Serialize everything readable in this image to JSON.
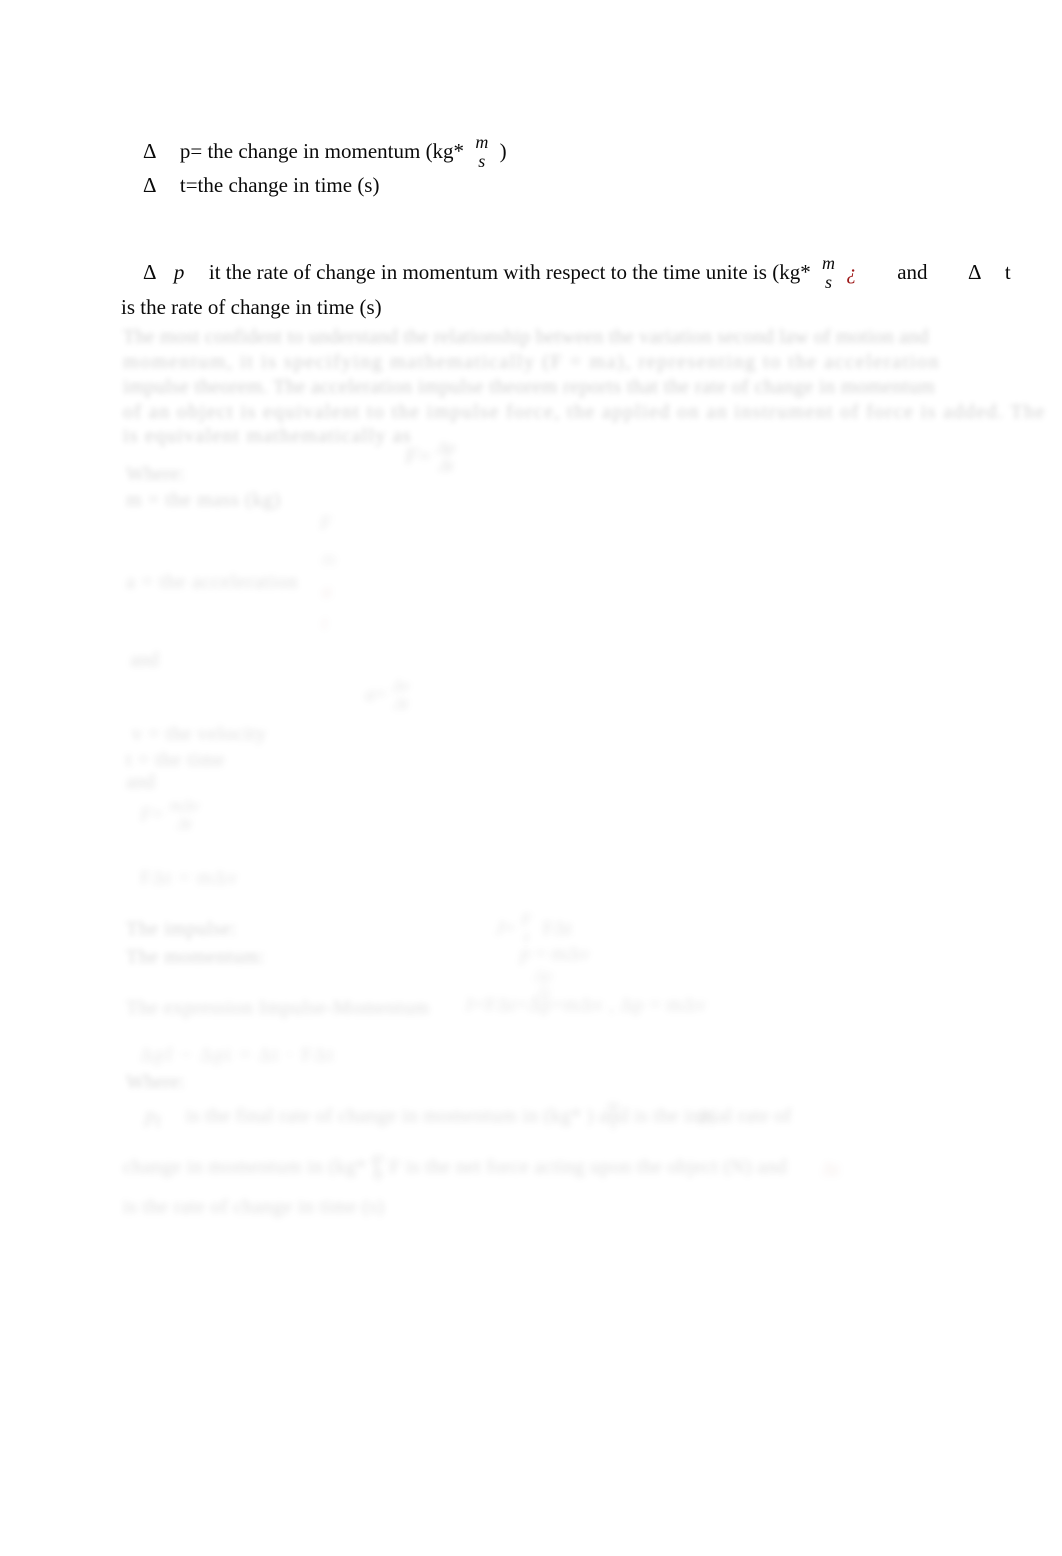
{
  "document": {
    "type": "physics-notes",
    "topic": "Impulse and momentum",
    "page_background": "#ffffff",
    "text_color": "#0a0a0a",
    "accent_color": "#9e1a1a"
  },
  "legible": {
    "line1": {
      "delta": "Δ",
      "before_fraction": "p= the change in momentum (kg*",
      "fraction_numerator": "m",
      "fraction_denominator": "s",
      "after_fraction": ")"
    },
    "line2": {
      "delta": "Δ",
      "text": "t=the change in time (s)"
    },
    "paragraph": {
      "delta": "Δ",
      "symbol": "p",
      "text_before_fraction": "it the rate of change in momentum with respect to the time unite is (kg*",
      "fraction_numerator": "m",
      "fraction_denominator": "s",
      "red_marker": "¿",
      "conjunction": "and",
      "delta2": "Δ",
      "symbol2": "t",
      "second_line": "is the rate of change in time (s)"
    }
  },
  "faded": {
    "note": "Lower portion of the page is faded and blurred to illegibility in the source scan.",
    "body_paragraph": [
      "The most confident to understand the relationship between the variation second law of motion and",
      "momentum, it is specifying mathematically (F = ma), representing to the acceleration",
      "impulse theorem. The acceleration impulse theorem reports that the rate of change in momentum",
      "of an object is equivalent to the impulse force, the applied on an instrument of force is added. The",
      "is equivalent mathematically as"
    ],
    "where_label": "Where:",
    "where_items": [
      "m = the mass (kg)",
      "a = the acceleration"
    ],
    "and_label": "and",
    "velocity_items": [
      "v = the velocity",
      "t = the time"
    ],
    "and_label2": "and",
    "impulse_label": "The impulse:",
    "momentum_label": "The momentum:",
    "expression_label": "The expression Impulse-Momentum",
    "where_label2": "Where:",
    "closing_paragraph": [
      "is the final rate of change in momentum in (kg*          ) and          is the initial rate of",
      "change in momentum in (kg*          ), F is the net force acting upon the object (N)          and",
      "is the rate of change in time (s)"
    ]
  }
}
